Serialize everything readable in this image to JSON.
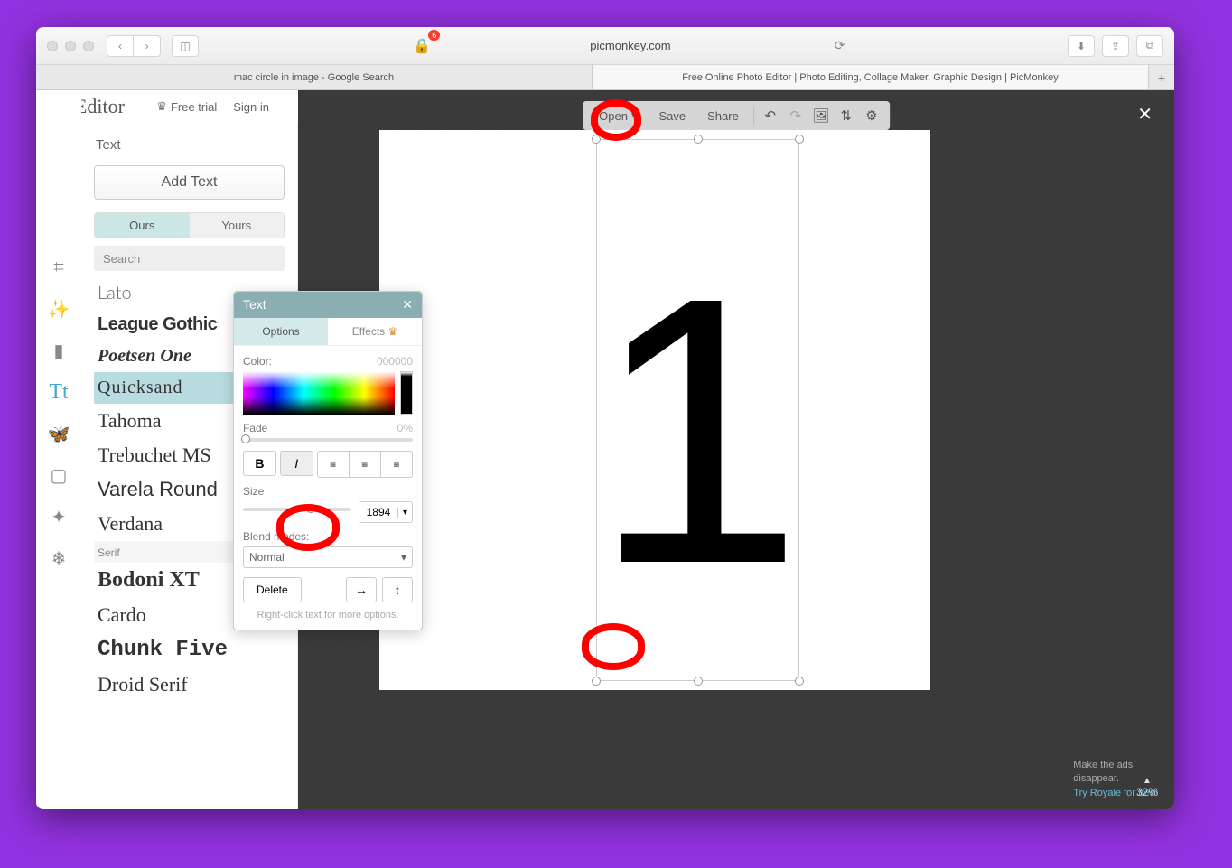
{
  "browser": {
    "url": "picmonkey.com",
    "notification_count": "6",
    "tabs": [
      "mac circle in image - Google Search",
      "Free Online Photo Editor | Photo Editing, Collage Maker, Graphic Design | PicMonkey"
    ]
  },
  "app": {
    "logo_text": "Editor",
    "header_links": {
      "free_trial": "Free trial",
      "sign_in": "Sign in"
    }
  },
  "text_panel": {
    "title": "Text",
    "add_button": "Add Text",
    "segments": {
      "ours": "Ours",
      "yours": "Yours"
    },
    "search_placeholder": "Search",
    "fonts_sans": [
      {
        "label": "Lato",
        "css": "font-family:Lato,Arial;font-weight:300;color:#666;"
      },
      {
        "label": "League Gothic",
        "css": "font-family:'Arial Narrow',sans-serif;font-weight:700;letter-spacing:-.5px;"
      },
      {
        "label": "Poetsen One",
        "css": "font-family:Arial Black;font-style:italic;font-weight:900;"
      },
      {
        "label": "Quicksand",
        "css": "font-family:Verdana;letter-spacing:1px;",
        "selected": true
      },
      {
        "label": "Tahoma",
        "css": "font-family:Tahoma;font-size:22px;"
      },
      {
        "label": "Trebuchet MS",
        "css": "font-family:'Trebuchet MS';font-size:22px;"
      },
      {
        "label": "Varela Round",
        "css": "font-family:Arial;font-size:22px;"
      },
      {
        "label": "Verdana",
        "css": "font-family:Verdana;font-size:22px;"
      }
    ],
    "serif_header": "Serif",
    "fonts_serif": [
      {
        "label": "Bodoni XT",
        "css": "font-family:'Bodoni MT',Didot,serif;font-weight:700;font-size:24px;"
      },
      {
        "label": "Cardo",
        "css": "font-family:Georgia,serif;font-size:22px;"
      },
      {
        "label": "Chunk Five",
        "css": "font-family:'Rockwell','Courier New';font-weight:900;font-size:24px;"
      },
      {
        "label": "Droid Serif",
        "css": "font-family:Georgia,serif;font-size:22px;"
      }
    ]
  },
  "toolbar": {
    "open": "Open",
    "save": "Save",
    "share": "Share"
  },
  "popup": {
    "title": "Text",
    "tabs": {
      "options": "Options",
      "effects": "Effects"
    },
    "color_label": "Color:",
    "color_value": "000000",
    "fade_label": "Fade",
    "fade_value": "0%",
    "size_label": "Size",
    "size_value": "1894",
    "blend_label": "Blend modes:",
    "blend_value": "Normal",
    "delete": "Delete",
    "hint": "Right-click text for more options."
  },
  "canvas": {
    "text": "1",
    "zoom": "32%"
  },
  "footer": {
    "ad1": "Make the ads",
    "ad2": "disappear.",
    "ad_link": "Try Royale for free!"
  }
}
